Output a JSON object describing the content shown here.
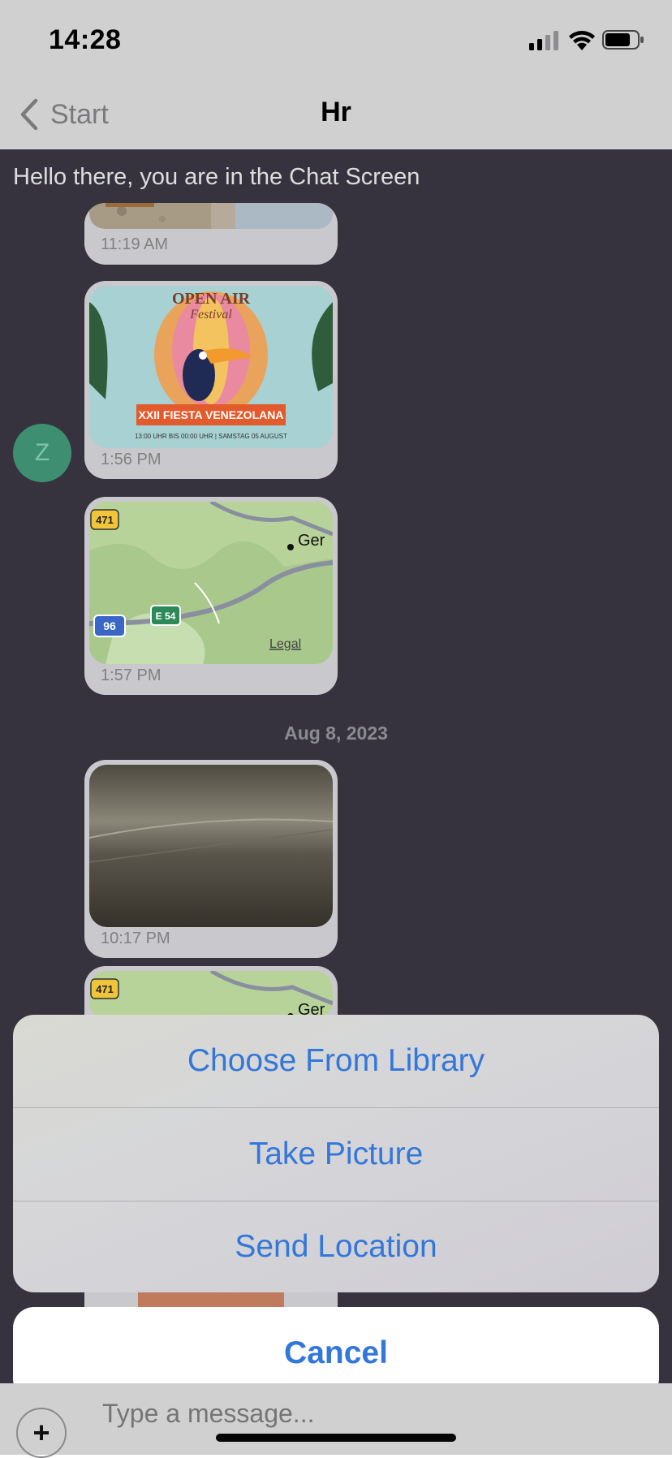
{
  "status_bar": {
    "time": "14:28"
  },
  "nav": {
    "back_label": "Start",
    "title": "Hr"
  },
  "chat": {
    "banner": "Hello there, you are in the Chat Screen",
    "avatar_initial": "Z",
    "messages": [
      {
        "type": "image",
        "timestamp": "11:19 AM"
      },
      {
        "type": "image",
        "timestamp": "1:56 PM",
        "poster_text": {
          "heading": "OPEN AIR",
          "script": "Festival",
          "banner": "XXII FIESTA VENEZOLANA",
          "footer": "13:00 UHR BIS 00:00 UHR | SAMSTAG 05 AUGUST"
        }
      },
      {
        "type": "location",
        "timestamp": "1:57 PM",
        "map_labels": {
          "shield_471": "471",
          "shield_96": "96",
          "shield_e54": "E 54",
          "place": "Ger",
          "legal": "Legal"
        }
      },
      {
        "type": "image",
        "timestamp": "10:17 PM"
      },
      {
        "type": "location",
        "map_labels": {
          "shield_471": "471",
          "place": "Ger"
        }
      }
    ],
    "date_separator": "Aug 8, 2023"
  },
  "action_sheet": {
    "options": [
      "Choose From Library",
      "Take Picture",
      "Send Location"
    ],
    "cancel": "Cancel"
  },
  "composer": {
    "placeholder": "Type a message...",
    "plus_symbol": "+"
  },
  "colors": {
    "accent": "#3477da",
    "chat_bg": "#36333f",
    "avatar": "#3e8f72"
  }
}
